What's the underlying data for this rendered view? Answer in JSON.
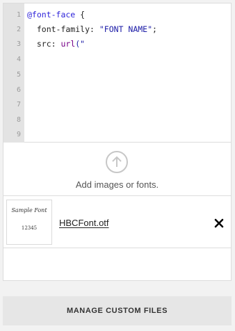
{
  "editor": {
    "line_numbers": [
      "1",
      "2",
      "3",
      "4",
      "5",
      "6",
      "7",
      "8",
      "9"
    ],
    "lines": [
      {
        "keyword": "@font-face",
        "rest": " {"
      },
      {
        "property": "  font-family: ",
        "string": "\"FONT NAME\"",
        "end": ";"
      },
      {
        "property": "  src: ",
        "func": "url",
        "string": "(\"",
        "end": ""
      }
    ]
  },
  "upload": {
    "icon": "arrow-up-circle-icon",
    "label": "Add images or fonts."
  },
  "files": [
    {
      "name": "HBCFont.otf",
      "thumb_title": "Sample Font",
      "thumb_digits": "12345",
      "remove_icon": "close-icon"
    }
  ],
  "footer": {
    "manage_label": "MANAGE CUSTOM FILES"
  }
}
